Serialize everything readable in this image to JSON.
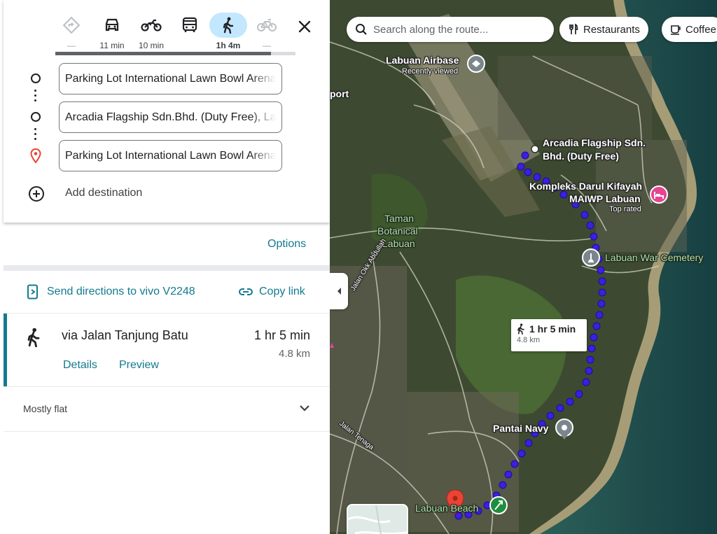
{
  "travel_modes": [
    {
      "name": "best",
      "icon": "directions-diamond-icon",
      "duration": "—",
      "active": false
    },
    {
      "name": "driving",
      "icon": "car-icon",
      "duration": "11 min",
      "active": false
    },
    {
      "name": "motorcycle",
      "icon": "motorcycle-icon",
      "duration": "10 min",
      "active": false
    },
    {
      "name": "transit",
      "icon": "bus-icon",
      "duration": "",
      "active": false
    },
    {
      "name": "walking",
      "icon": "walk-icon",
      "duration": "1h 4m",
      "active": true
    },
    {
      "name": "cycling",
      "icon": "bicycle-icon",
      "duration": "—",
      "active": false
    }
  ],
  "waypoints": [
    {
      "value": "Parking Lot International Lawn Bowl Arena",
      "icon": "circle-icon"
    },
    {
      "value": "Arcadia Flagship Sdn.Bhd. (Duty Free), Labuan",
      "icon": "circle-icon"
    },
    {
      "value": "Parking Lot International Lawn Bowl Arena",
      "icon": "red-pin-icon"
    }
  ],
  "add_destination": "Add destination",
  "options": "Options",
  "send_directions": "Send directions to vivo V2248",
  "copy_link": "Copy link",
  "route": {
    "via": "via Jalan Tanjung Batu",
    "duration": "1 hr 5 min",
    "distance": "4.8 km",
    "details": "Details",
    "preview": "Preview"
  },
  "elevation": "Mostly flat",
  "map": {
    "search_placeholder": "Search along the route...",
    "chips": [
      {
        "label": "Restaurants",
        "icon": "fork-knife-icon"
      },
      {
        "label": "Coffee",
        "icon": "coffee-cup-icon"
      }
    ],
    "places": {
      "airbase": "Labuan Airbase",
      "airbase_sub": "Recently viewed",
      "airport": "port",
      "arcadia_1": "Arcadia Flagship Sdn.",
      "arcadia_2": "Bhd. (Duty Free)",
      "kompleks_1": "Kompleks Darul Kifayah",
      "kompleks_2": "MAIWP Labuan",
      "kompleks_sub": "Top rated",
      "taman_1": "Taman",
      "taman_2": "Botanical",
      "taman_3": "Labuan",
      "war_cemetery": "Labuan War Cemetery",
      "pantai_navy": "Pantai Navy",
      "labuan_beach": "Labuan Beach",
      "road_okk": "Jalan Okk Abdullah",
      "road_tenaga": "Jalan Tenaga"
    },
    "eta_bubble": {
      "duration": "1 hr 5 min",
      "distance": "4.8 km"
    },
    "route_color": "#3d1fe0"
  },
  "colors": {
    "accent": "#137a8f",
    "active_mode_bg": "#c2e7ff",
    "pin_red": "#ea4335"
  }
}
